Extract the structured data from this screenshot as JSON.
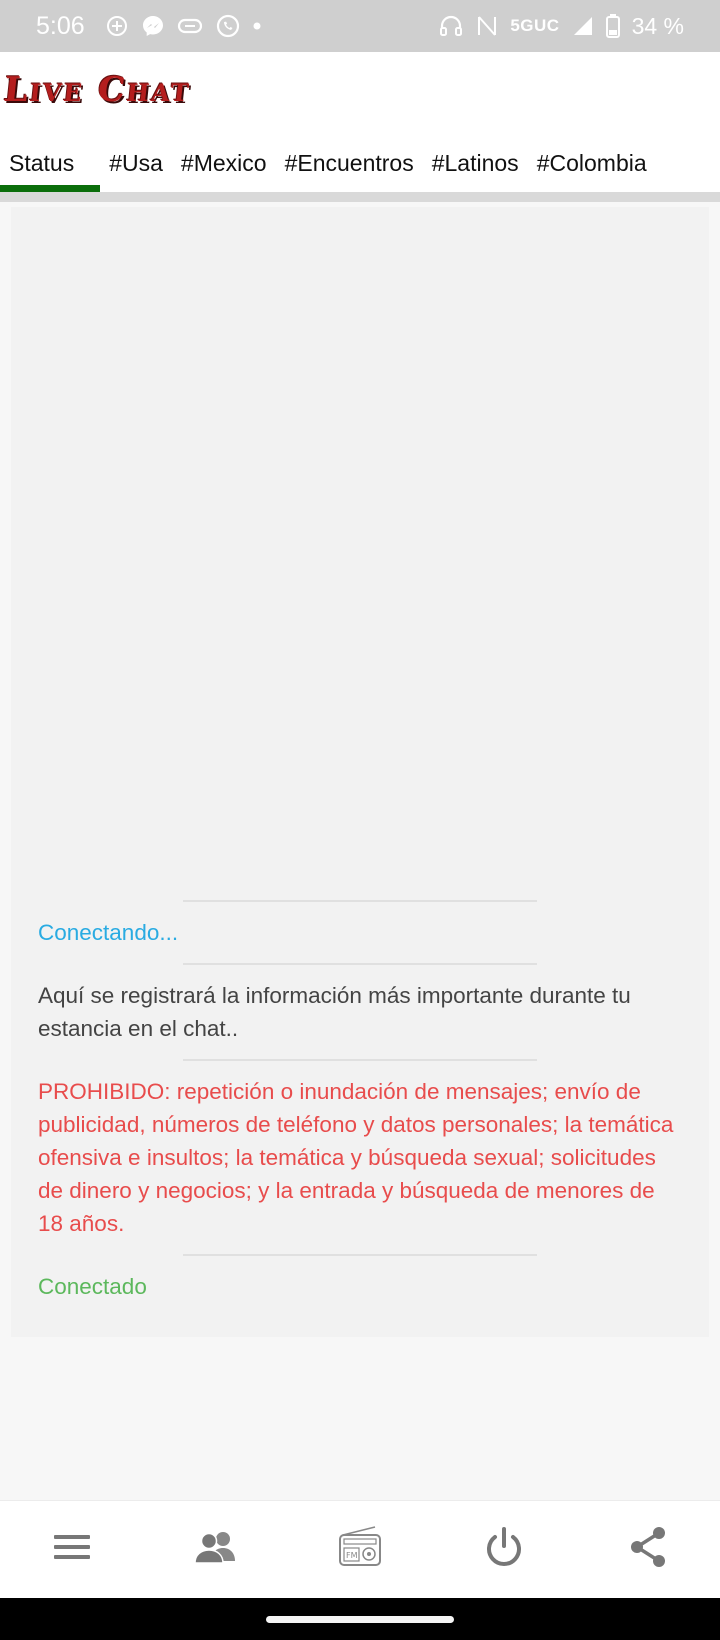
{
  "statusbar": {
    "time": "5:06",
    "network": "5GUC",
    "battery": "34 %",
    "icons": [
      "add-circle-icon",
      "messenger-icon",
      "chat-bubble-icon",
      "whatsapp-icon",
      "dot-icon",
      "headphones-icon",
      "nfc-icon",
      "signal-icon",
      "battery-icon"
    ]
  },
  "header": {
    "logo": "Live Chat",
    "tabs": [
      {
        "label": "Status",
        "active": true
      },
      {
        "label": "#Usa"
      },
      {
        "label": "#Mexico"
      },
      {
        "label": "#Encuentros"
      },
      {
        "label": "#Latinos"
      },
      {
        "label": "#Colombia"
      }
    ]
  },
  "log": {
    "entries": [
      {
        "type": "connecting",
        "text": "Conectando..."
      },
      {
        "type": "info",
        "text": "Aquí se registrará la información más importante durante tu estancia en el chat.."
      },
      {
        "type": "warn",
        "text": "PROHIBIDO: repetición o inundación de mensajes; envío de publicidad, números de teléfono y datos personales; la temática ofensiva e insultos; la temática y búsqueda sexual; solicitudes de dinero y negocios; y la entrada y búsqueda de menores de 18 años."
      },
      {
        "type": "ok",
        "text": "Conectado"
      }
    ]
  },
  "bottomnav": {
    "items": [
      "menu-icon",
      "users-icon",
      "radio-icon",
      "power-icon",
      "share-icon"
    ]
  },
  "colors": {
    "accent_green": "#0b6e0b",
    "connecting": "#29abe2",
    "warning": "#e84c4c",
    "connected": "#5cb85c",
    "logo_red": "#b41e1e"
  }
}
